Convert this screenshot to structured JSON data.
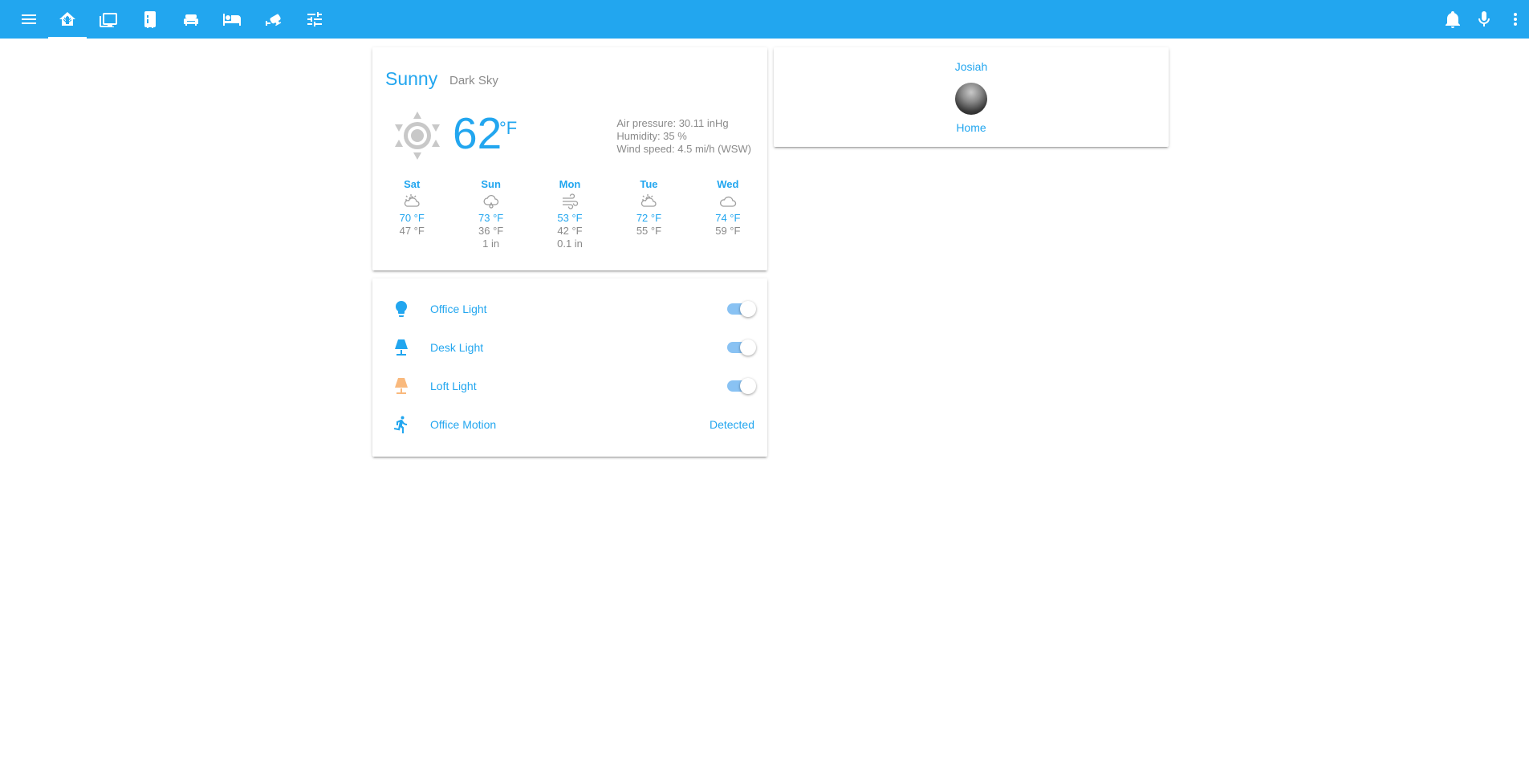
{
  "toolbar": {
    "left_icons": [
      "menu-icon",
      "home-assistant-icon",
      "monitor-icon",
      "fridge-icon",
      "sofa-icon",
      "bed-icon",
      "cctv-icon",
      "tune-icon"
    ],
    "right_icons": [
      "bell-icon",
      "microphone-icon",
      "dots-vertical-icon"
    ],
    "accent": "#22a6ef"
  },
  "weather": {
    "condition": "Sunny",
    "source": "Dark Sky",
    "temperature": "62",
    "unit": "°F",
    "air_pressure": "Air pressure: 30.11 inHg",
    "humidity": "Humidity: 35 %",
    "wind_speed": "Wind speed: 4.5 mi/h (WSW)",
    "forecast": [
      {
        "day": "Sat",
        "icon": "partly-cloudy-icon",
        "high": "70 °F",
        "low": "47 °F",
        "precip": ""
      },
      {
        "day": "Sun",
        "icon": "rain-icon",
        "high": "73 °F",
        "low": "36 °F",
        "precip": "1 in"
      },
      {
        "day": "Mon",
        "icon": "wind-icon",
        "high": "53 °F",
        "low": "42 °F",
        "precip": "0.1 in"
      },
      {
        "day": "Tue",
        "icon": "partly-cloudy-icon",
        "high": "72 °F",
        "low": "55 °F",
        "precip": ""
      },
      {
        "day": "Wed",
        "icon": "cloudy-icon",
        "high": "74 °F",
        "low": "59 °F",
        "precip": ""
      }
    ]
  },
  "entities": [
    {
      "label": "Office Light",
      "icon": "lightbulb-icon",
      "icon_color": "#22a6ef",
      "type": "toggle",
      "state": "on"
    },
    {
      "label": "Desk Light",
      "icon": "lamp-icon",
      "icon_color": "#22a6ef",
      "type": "toggle",
      "state": "on"
    },
    {
      "label": "Loft Light",
      "icon": "lamp-icon",
      "icon_color": "#f9b97d",
      "type": "toggle",
      "state": "on"
    },
    {
      "label": "Office Motion",
      "icon": "run-icon",
      "icon_color": "#22a6ef",
      "type": "state",
      "state": "Detected"
    }
  ],
  "person": {
    "name": "Josiah",
    "state": "Home"
  }
}
